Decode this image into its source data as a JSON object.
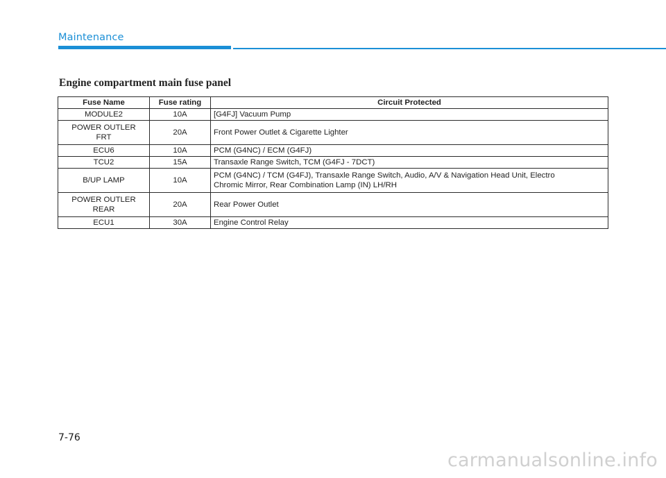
{
  "header": {
    "section_label": "Maintenance",
    "accent_color": "#1b8fd6"
  },
  "section_title": "Engine compartment main fuse panel",
  "table": {
    "columns": [
      "Fuse Name",
      "Fuse rating",
      "Circuit Protected"
    ],
    "rows": [
      {
        "name": [
          "MODULE2"
        ],
        "rating": "10A",
        "circuit": [
          "[G4FJ] Vacuum Pump"
        ]
      },
      {
        "name": [
          "POWER OUTLER",
          "FRT"
        ],
        "rating": "20A",
        "circuit": [
          "Front Power Outlet & Cigarette Lighter"
        ]
      },
      {
        "name": [
          "ECU6"
        ],
        "rating": "10A",
        "circuit": [
          "PCM (G4NC) / ECM (G4FJ)"
        ]
      },
      {
        "name": [
          "TCU2"
        ],
        "rating": "15A",
        "circuit": [
          "Transaxle Range Switch, TCM (G4FJ - 7DCT)"
        ]
      },
      {
        "name": [
          "B/UP LAMP"
        ],
        "rating": "10A",
        "circuit": [
          "PCM (G4NC) / TCM (G4FJ), Transaxle Range Switch, Audio, A/V & Navigation Head Unit, Electro",
          "Chromic Mirror, Rear Combination Lamp (IN) LH/RH"
        ]
      },
      {
        "name": [
          "POWER OUTLER",
          "REAR"
        ],
        "rating": "20A",
        "circuit": [
          "Rear Power Outlet"
        ]
      },
      {
        "name": [
          "ECU1"
        ],
        "rating": "30A",
        "circuit": [
          "Engine Control Relay"
        ]
      }
    ]
  },
  "footer": {
    "page_number": "7-76",
    "watermark": "carmanualsonline.info"
  }
}
